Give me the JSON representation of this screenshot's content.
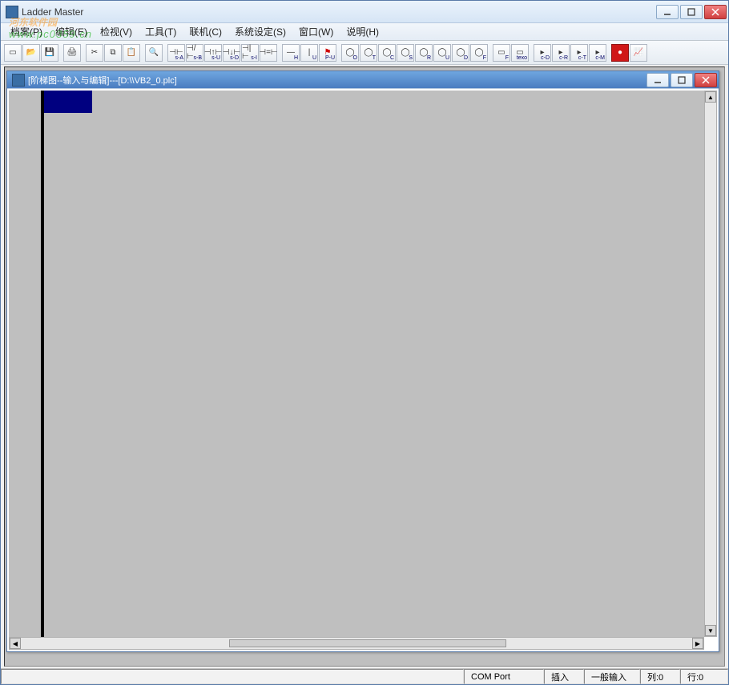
{
  "app": {
    "title": "Ladder Master"
  },
  "menu": {
    "items": [
      {
        "label": "档案(P)"
      },
      {
        "label": "编辑(E)"
      },
      {
        "label": "检视(V)"
      },
      {
        "label": "工具(T)"
      },
      {
        "label": "联机(C)"
      },
      {
        "label": "系统设定(S)"
      },
      {
        "label": "窗口(W)"
      },
      {
        "label": "说明(H)"
      }
    ]
  },
  "toolbar": {
    "buttons": [
      {
        "name": "new-icon",
        "glyph": "▭",
        "sub": ""
      },
      {
        "name": "open-icon",
        "glyph": "📂",
        "sub": ""
      },
      {
        "name": "save-icon",
        "glyph": "💾",
        "sub": ""
      },
      {
        "name": "sep"
      },
      {
        "name": "print-icon",
        "glyph": "🖨",
        "sub": ""
      },
      {
        "name": "sep"
      },
      {
        "name": "cut-icon",
        "glyph": "✂",
        "sub": ""
      },
      {
        "name": "copy-icon",
        "glyph": "⧉",
        "sub": ""
      },
      {
        "name": "paste-icon",
        "glyph": "📋",
        "sub": ""
      },
      {
        "name": "sep"
      },
      {
        "name": "find-icon",
        "glyph": "🔍",
        "sub": ""
      },
      {
        "name": "sep"
      },
      {
        "name": "contact-a-icon",
        "glyph": "⊣⊢",
        "sub": "s-A"
      },
      {
        "name": "contact-b-icon",
        "glyph": "⊣/⊢",
        "sub": "s-B"
      },
      {
        "name": "contact-u-icon",
        "glyph": "⊣↑⊢",
        "sub": "s-U"
      },
      {
        "name": "contact-d-icon",
        "glyph": "⊣↓⊢",
        "sub": "s-D"
      },
      {
        "name": "contact-i-icon",
        "glyph": "⊣|⊢",
        "sub": "s-I"
      },
      {
        "name": "contact-eq-icon",
        "glyph": "⊣=⊢",
        "sub": ""
      },
      {
        "name": "sep"
      },
      {
        "name": "hline-icon",
        "glyph": "—",
        "sub": "H"
      },
      {
        "name": "vline-icon",
        "glyph": "|",
        "sub": "U"
      },
      {
        "name": "flag-icon",
        "glyph": "⚑",
        "sub": "P-U",
        "red": true
      },
      {
        "name": "sep"
      },
      {
        "name": "coil-o-icon",
        "glyph": "◯",
        "sub": "O"
      },
      {
        "name": "coil-t-icon",
        "glyph": "◯",
        "sub": "T"
      },
      {
        "name": "coil-c-icon",
        "glyph": "◯",
        "sub": "C"
      },
      {
        "name": "coil-s-icon",
        "glyph": "◯",
        "sub": "S"
      },
      {
        "name": "coil-r-icon",
        "glyph": "◯",
        "sub": "R"
      },
      {
        "name": "coil-u-icon",
        "glyph": "◯",
        "sub": "U"
      },
      {
        "name": "coil-d-icon",
        "glyph": "◯",
        "sub": "D"
      },
      {
        "name": "coil-f-icon",
        "glyph": "◯",
        "sub": "F"
      },
      {
        "name": "sep"
      },
      {
        "name": "func-icon",
        "glyph": "▭",
        "sub": "F"
      },
      {
        "name": "text-icon",
        "glyph": "▭",
        "sub": "texo"
      },
      {
        "name": "sep"
      },
      {
        "name": "cd-icon",
        "glyph": "▸",
        "sub": "c-D"
      },
      {
        "name": "cr-icon",
        "glyph": "▸",
        "sub": "c-R"
      },
      {
        "name": "ct-icon",
        "glyph": "▸",
        "sub": "c-T"
      },
      {
        "name": "cm-icon",
        "glyph": "▸",
        "sub": "c-M"
      },
      {
        "name": "sep"
      },
      {
        "name": "record-icon",
        "glyph": "●",
        "sub": "",
        "filledRed": true
      },
      {
        "name": "chart-icon",
        "glyph": "📈",
        "sub": ""
      }
    ]
  },
  "child": {
    "title": "[阶梯图--输入与编辑]---[D:\\\\VB2_0.plc]"
  },
  "status": {
    "comPort": "COM Port",
    "insert": "插入",
    "inputMode": "一般输入",
    "col": "列:0",
    "row": "行:0"
  },
  "watermark": {
    "main": "河东软件园",
    "sub": "www.pc0359.cn"
  }
}
